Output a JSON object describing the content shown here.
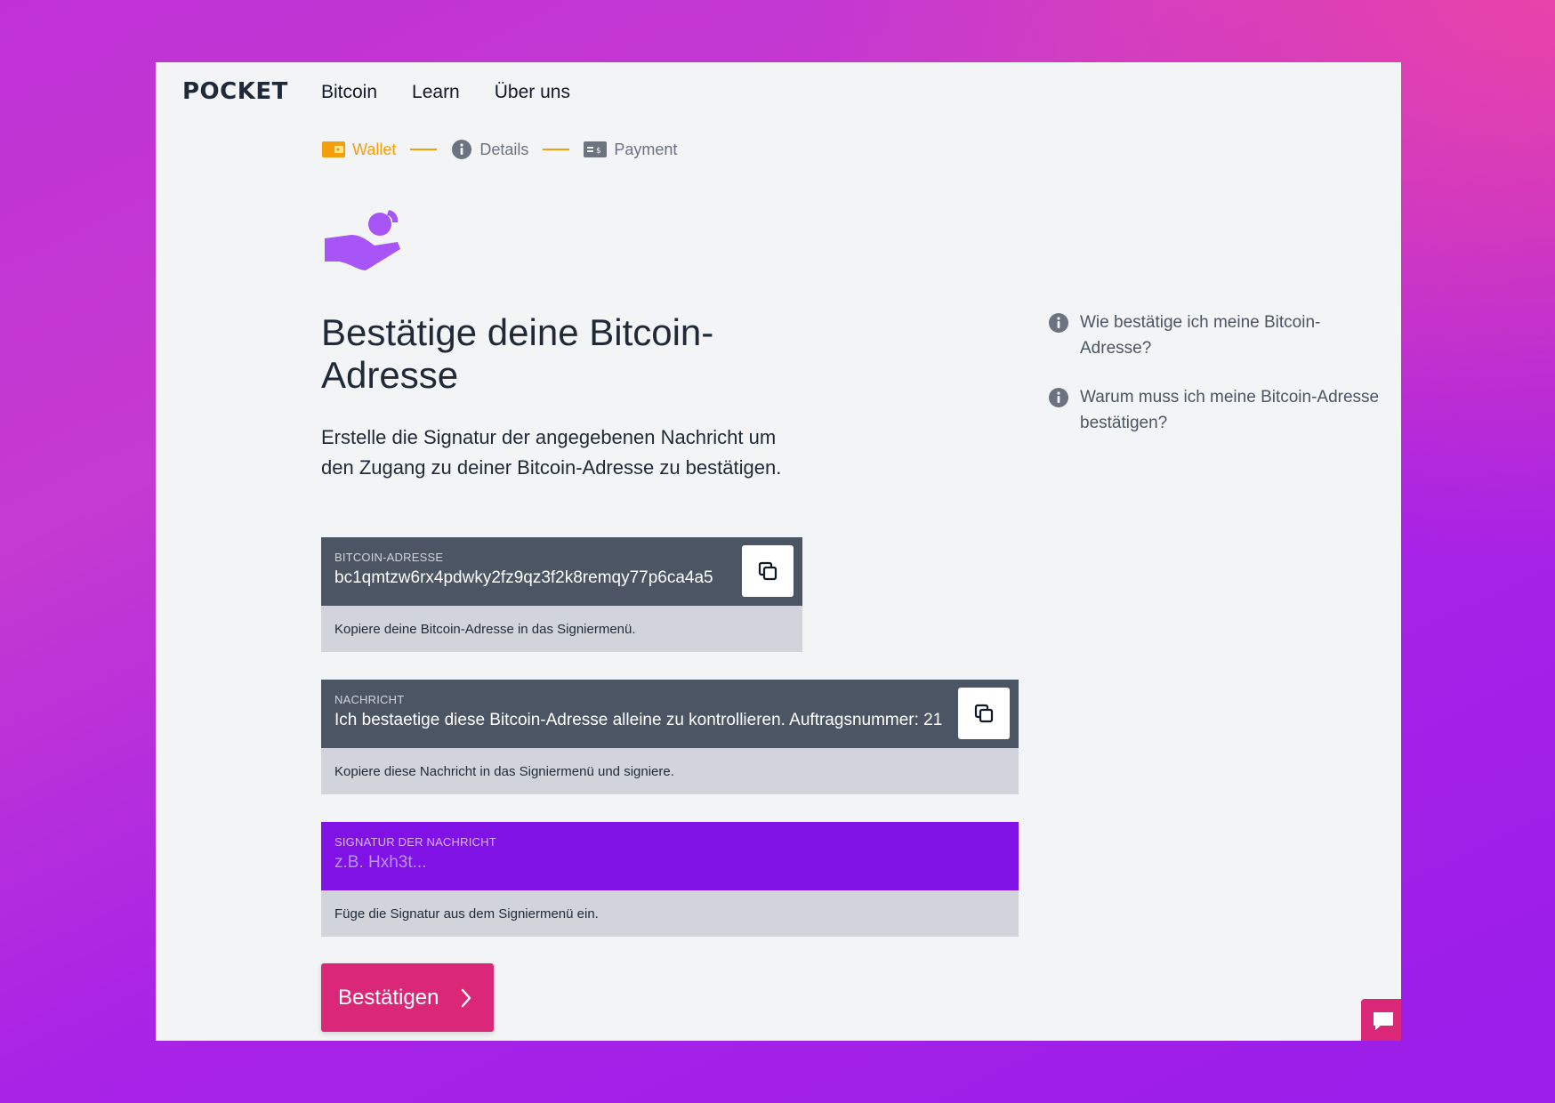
{
  "brand": {
    "logo": "POCKET"
  },
  "nav": {
    "items": [
      "Bitcoin",
      "Learn",
      "Über uns"
    ]
  },
  "stepper": {
    "steps": [
      {
        "label": "Wallet",
        "state": "active"
      },
      {
        "label": "Details",
        "state": "pending"
      },
      {
        "label": "Payment",
        "state": "pending"
      }
    ]
  },
  "main": {
    "title": "Bestätige deine Bitcoin-Adresse",
    "intro": "Erstelle die Signatur der angegebenen Nachricht um den Zugang zu deiner Bitcoin-Adresse zu bestätigen.",
    "address_field": {
      "label": "Bitcoin-Adresse",
      "value": "bc1qmtzw6rx4pdwky2fz9qz3f2k8remqy77p6ca4a5",
      "help": "Kopiere deine Bitcoin-Adresse in das Signiermenü."
    },
    "message_field": {
      "label": "Nachricht",
      "value": "Ich bestaetige diese Bitcoin-Adresse alleine zu kontrollieren. Auftragsnummer: 21",
      "help": "Kopiere diese Nachricht in das Signiermenü und signiere."
    },
    "signature_field": {
      "label": "Signatur der Nachricht",
      "placeholder": "z.B. Hxh3t...",
      "help": "Füge die Signatur aus dem Signiermenü ein."
    },
    "confirm_label": "Bestätigen"
  },
  "faq": {
    "items": [
      "Wie bestätige ich meine Bitcoin-Adresse?",
      "Warum muss ich meine Bitcoin-Adresse bestätigen?"
    ]
  },
  "colors": {
    "accent": "#f59e0b",
    "primary": "#db2777",
    "signature_bg": "#8112e6",
    "field_bg": "#4b5563",
    "hero_icon": "#a855f7"
  },
  "icons": {
    "wallet": "wallet-icon",
    "details": "info-icon",
    "payment": "payment-card-icon",
    "hero": "hand-coin-icon",
    "copy": "copy-icon",
    "faq": "info-icon",
    "chat": "chat-icon",
    "confirm": "chevron-right-icon"
  }
}
